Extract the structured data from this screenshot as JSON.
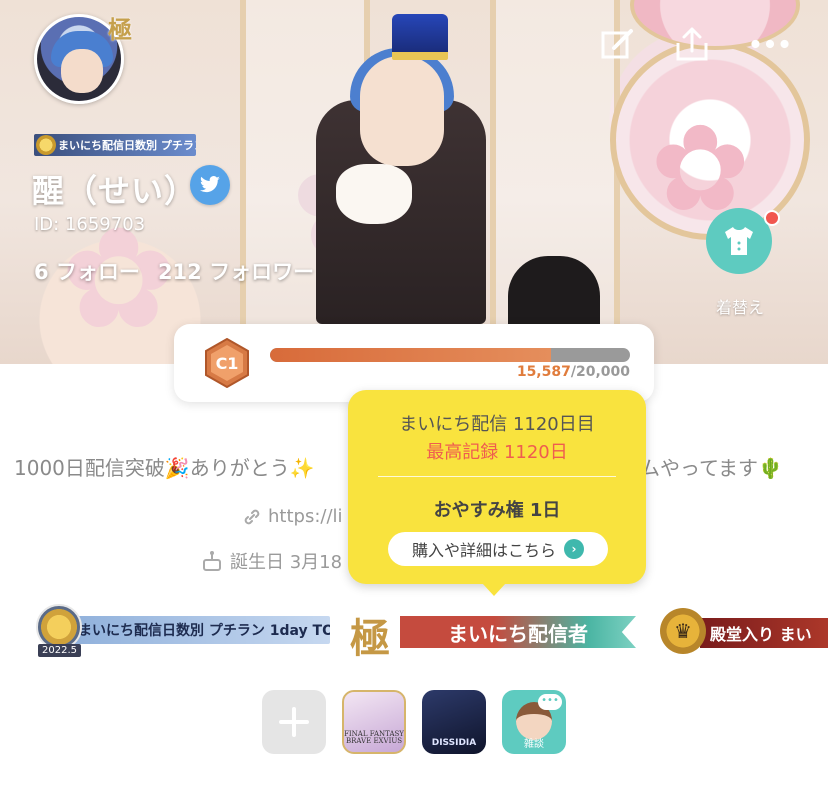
{
  "profile": {
    "username": "醒（せい）",
    "id_text": "ID: 1659703",
    "following": "6 フォロー",
    "followers": "212 フォロワー",
    "avatar_badge": "極",
    "mini_badge": "まいにち配信日数別 プチラン 1day TOP3"
  },
  "header": {
    "wardrobe_label": "着替え",
    "icons": [
      "edit-icon",
      "share-icon",
      "more-icon"
    ]
  },
  "level": {
    "rank": "C1",
    "current": "15,587",
    "max": "/20,000",
    "progress_fraction": 0.78
  },
  "bio": {
    "text_left": "1000日配信突破🎉ありがとう✨",
    "text_right": "ムやってます🌵",
    "link": "https://li",
    "birthday": "誕生日 3月18"
  },
  "tooltip": {
    "streak": "まいにち配信 1120日目",
    "record": "最高記録 1120日",
    "rest": "おやすみ権 1日",
    "button": "購入や詳細はこちら"
  },
  "badges": {
    "daily_rank": "まいにち配信日数別 プチラン 1day TOP3",
    "daily_rank_year": "2022.5",
    "kiwami_kanji": "極",
    "kiwami_label": "まいにち配信者",
    "hall_of_fame": "殿堂入り まい"
  },
  "apps": {
    "ffbe": "FINAL FANTASY BRAVE EXVIUS",
    "dff": "DISSIDIA",
    "chat": "雑談"
  },
  "colors": {
    "teal": "#5ecbc0",
    "tooltip": "#f9e33e",
    "record_red": "#ef5d4f",
    "progress": "#e07c3c",
    "twitter": "#56a3e8"
  }
}
